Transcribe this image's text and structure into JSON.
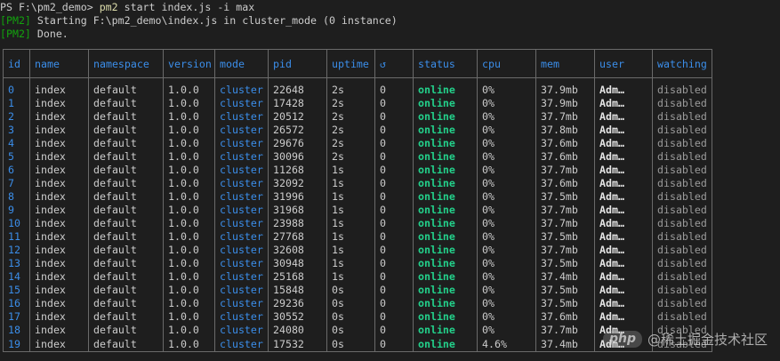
{
  "terminal": {
    "prompt": "PS F:\\pm2_demo> ",
    "command": "pm2",
    "args": " start index.js -i max",
    "msg_tag": "[PM2]",
    "msg_start": " Starting F:\\pm2_demo\\index.js in cluster_mode (0 instance)",
    "msg_done": " Done."
  },
  "table": {
    "headers": [
      "id",
      "name",
      "namespace",
      "version",
      "mode",
      "pid",
      "uptime",
      "↺",
      "status",
      "cpu",
      "mem",
      "user",
      "watching"
    ],
    "rows": [
      [
        "0",
        "index",
        "default",
        "1.0.0",
        "cluster",
        "22648",
        "2s",
        "0",
        "online",
        "0%",
        "37.9mb",
        "Adm…",
        "disabled"
      ],
      [
        "1",
        "index",
        "default",
        "1.0.0",
        "cluster",
        "17428",
        "2s",
        "0",
        "online",
        "0%",
        "37.9mb",
        "Adm…",
        "disabled"
      ],
      [
        "2",
        "index",
        "default",
        "1.0.0",
        "cluster",
        "20512",
        "2s",
        "0",
        "online",
        "0%",
        "37.7mb",
        "Adm…",
        "disabled"
      ],
      [
        "3",
        "index",
        "default",
        "1.0.0",
        "cluster",
        "26572",
        "2s",
        "0",
        "online",
        "0%",
        "37.8mb",
        "Adm…",
        "disabled"
      ],
      [
        "4",
        "index",
        "default",
        "1.0.0",
        "cluster",
        "29676",
        "2s",
        "0",
        "online",
        "0%",
        "37.6mb",
        "Adm…",
        "disabled"
      ],
      [
        "5",
        "index",
        "default",
        "1.0.0",
        "cluster",
        "30096",
        "2s",
        "0",
        "online",
        "0%",
        "37.6mb",
        "Adm…",
        "disabled"
      ],
      [
        "6",
        "index",
        "default",
        "1.0.0",
        "cluster",
        "11268",
        "1s",
        "0",
        "online",
        "0%",
        "37.7mb",
        "Adm…",
        "disabled"
      ],
      [
        "7",
        "index",
        "default",
        "1.0.0",
        "cluster",
        "32092",
        "1s",
        "0",
        "online",
        "0%",
        "37.6mb",
        "Adm…",
        "disabled"
      ],
      [
        "8",
        "index",
        "default",
        "1.0.0",
        "cluster",
        "31996",
        "1s",
        "0",
        "online",
        "0%",
        "37.5mb",
        "Adm…",
        "disabled"
      ],
      [
        "9",
        "index",
        "default",
        "1.0.0",
        "cluster",
        "31968",
        "1s",
        "0",
        "online",
        "0%",
        "37.7mb",
        "Adm…",
        "disabled"
      ],
      [
        "10",
        "index",
        "default",
        "1.0.0",
        "cluster",
        "23988",
        "1s",
        "0",
        "online",
        "0%",
        "37.7mb",
        "Adm…",
        "disabled"
      ],
      [
        "11",
        "index",
        "default",
        "1.0.0",
        "cluster",
        "27768",
        "1s",
        "0",
        "online",
        "0%",
        "37.5mb",
        "Adm…",
        "disabled"
      ],
      [
        "12",
        "index",
        "default",
        "1.0.0",
        "cluster",
        "32608",
        "1s",
        "0",
        "online",
        "0%",
        "37.7mb",
        "Adm…",
        "disabled"
      ],
      [
        "13",
        "index",
        "default",
        "1.0.0",
        "cluster",
        "30948",
        "1s",
        "0",
        "online",
        "0%",
        "37.5mb",
        "Adm…",
        "disabled"
      ],
      [
        "14",
        "index",
        "default",
        "1.0.0",
        "cluster",
        "25168",
        "1s",
        "0",
        "online",
        "0%",
        "37.4mb",
        "Adm…",
        "disabled"
      ],
      [
        "15",
        "index",
        "default",
        "1.0.0",
        "cluster",
        "15848",
        "0s",
        "0",
        "online",
        "0%",
        "37.5mb",
        "Adm…",
        "disabled"
      ],
      [
        "16",
        "index",
        "default",
        "1.0.0",
        "cluster",
        "29236",
        "0s",
        "0",
        "online",
        "0%",
        "37.5mb",
        "Adm…",
        "disabled"
      ],
      [
        "17",
        "index",
        "default",
        "1.0.0",
        "cluster",
        "30552",
        "0s",
        "0",
        "online",
        "0%",
        "37.6mb",
        "Adm…",
        "disabled"
      ],
      [
        "18",
        "index",
        "default",
        "1.0.0",
        "cluster",
        "24080",
        "0s",
        "0",
        "online",
        "0%",
        "37.7mb",
        "Adm…",
        "disabled"
      ],
      [
        "19",
        "index",
        "default",
        "1.0.0",
        "cluster",
        "17532",
        "0s",
        "0",
        "online",
        "4.6%",
        "37.4mb",
        "Adm…",
        "disabled"
      ]
    ]
  },
  "watermark": {
    "badge": "php",
    "text": "@稀土掘金技术社区"
  },
  "colors": {
    "background": "#1e1e1e",
    "header_blue": "#3b8eea",
    "status_green": "#23d18b",
    "pm2_tag_green": "#13a10e",
    "command_yellow": "#dcdcaa",
    "border_gray": "#6a6a6a"
  }
}
